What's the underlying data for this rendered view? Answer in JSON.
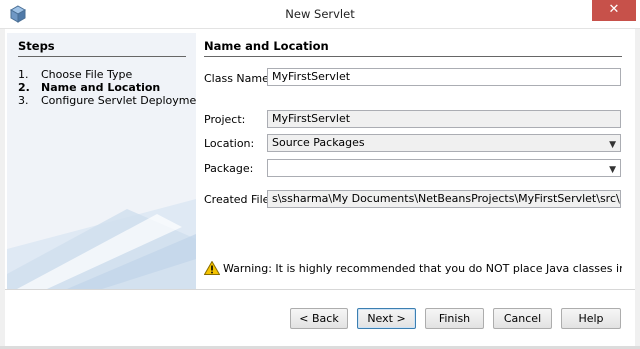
{
  "window": {
    "title": "New Servlet",
    "close_icon": "close-icon",
    "app_icon": "cube-icon"
  },
  "steps": {
    "title": "Steps",
    "items": [
      {
        "num": "1.",
        "label": "Choose File Type",
        "active": false
      },
      {
        "num": "2.",
        "label": "Name and Location",
        "active": true
      },
      {
        "num": "3.",
        "label": "Configure Servlet Deployment",
        "active": false
      }
    ]
  },
  "main": {
    "title": "Name and Location",
    "class_name": {
      "label": "Class Name:",
      "value": "MyFirstServlet"
    },
    "project": {
      "label": "Project:",
      "value": "MyFirstServlet"
    },
    "location": {
      "label": "Location:",
      "value": "Source Packages"
    },
    "package": {
      "label": "Package:",
      "value": ""
    },
    "created_file": {
      "label": "Created File:",
      "value": "s\\ssharma\\My Documents\\NetBeansProjects\\MyFirstServlet\\src\\java\\MyFirstS"
    },
    "warning": "Warning: It is highly recommended that you do NOT place Java classes in the default pac"
  },
  "buttons": {
    "back": "< Back",
    "next": "Next >",
    "finish": "Finish",
    "cancel": "Cancel",
    "help": "Help"
  },
  "colors": {
    "close_bg": "#c7514a",
    "default_button_border": "#3c7fb1",
    "steps_bg": "#f0f3f8"
  }
}
